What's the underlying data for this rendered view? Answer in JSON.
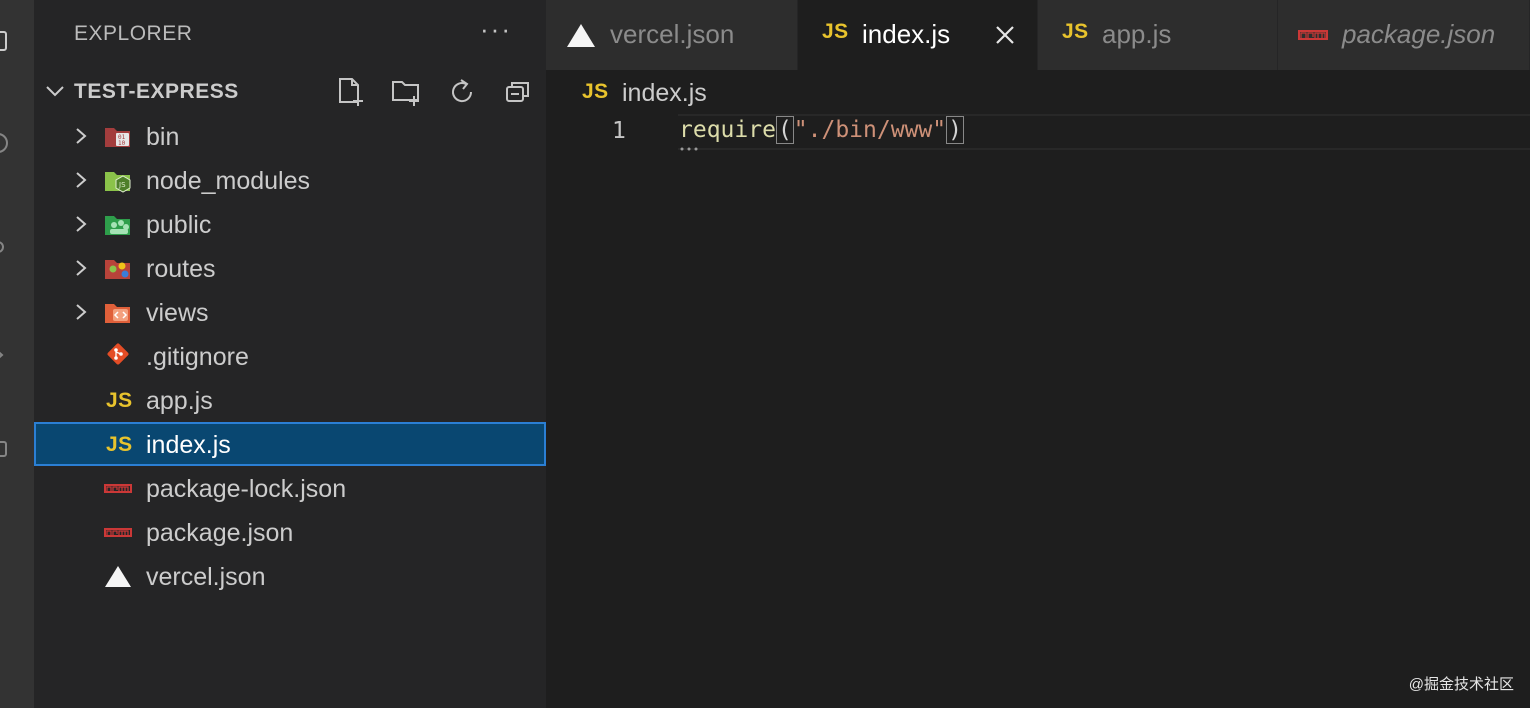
{
  "sidebar": {
    "header": "EXPLORER",
    "more_label": "···",
    "project": "TEST-EXPRESS",
    "items": [
      {
        "label": "bin",
        "type": "folder",
        "icon": "folder-bin-icon"
      },
      {
        "label": "node_modules",
        "type": "folder",
        "icon": "folder-node-icon"
      },
      {
        "label": "public",
        "type": "folder",
        "icon": "folder-public-icon"
      },
      {
        "label": "routes",
        "type": "folder",
        "icon": "folder-routes-icon"
      },
      {
        "label": "views",
        "type": "folder",
        "icon": "folder-views-icon"
      },
      {
        "label": ".gitignore",
        "type": "file",
        "icon": "git-icon"
      },
      {
        "label": "app.js",
        "type": "file",
        "icon": "js-icon"
      },
      {
        "label": "index.js",
        "type": "file",
        "icon": "js-icon",
        "selected": true
      },
      {
        "label": "package-lock.json",
        "type": "file",
        "icon": "npm-icon"
      },
      {
        "label": "package.json",
        "type": "file",
        "icon": "npm-icon"
      },
      {
        "label": "vercel.json",
        "type": "file",
        "icon": "vercel-icon"
      }
    ]
  },
  "tabs": [
    {
      "label": "vercel.json",
      "icon": "vercel-icon",
      "active": false
    },
    {
      "label": "index.js",
      "icon": "js-icon",
      "active": true
    },
    {
      "label": "app.js",
      "icon": "js-icon",
      "active": false
    },
    {
      "label": "package.json",
      "icon": "npm-icon",
      "active": false,
      "italic": true
    }
  ],
  "editor": {
    "breadcrumb": "index.js",
    "js_glyph": "JS",
    "line_number": "1",
    "code": {
      "fn": "require",
      "open_paren": "(",
      "string": "\"./bin/www\"",
      "close_paren": ")"
    }
  },
  "watermark": "@掘金技术社区",
  "colors": {
    "accent": "#094771",
    "js_yellow": "#e8c32d",
    "npm_red": "#cb3837",
    "string": "#ce9178",
    "function": "#dcdcaa"
  }
}
